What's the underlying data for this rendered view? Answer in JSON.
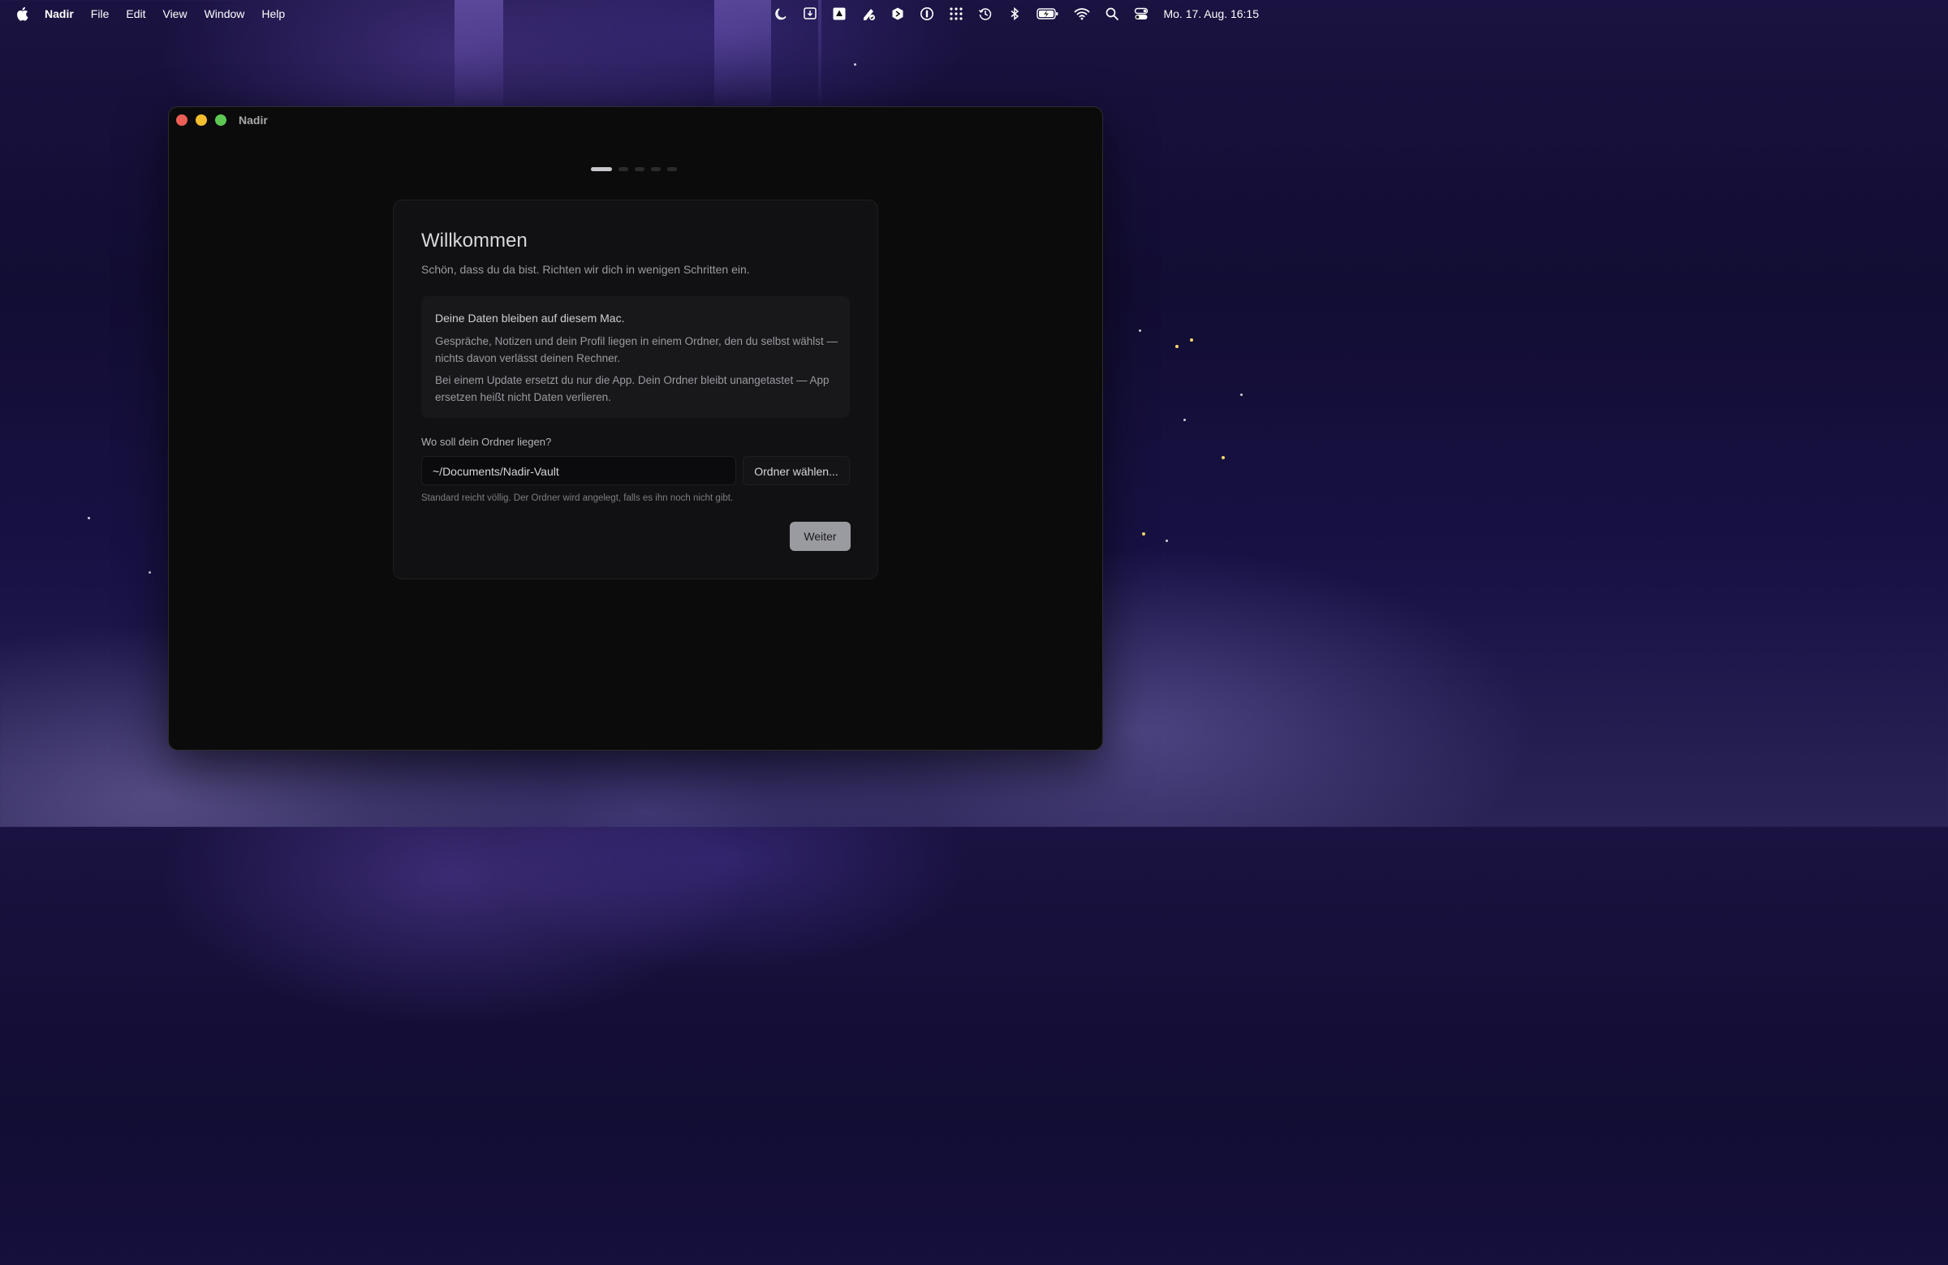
{
  "menubar": {
    "app_name": "Nadir",
    "items": [
      "File",
      "Edit",
      "View",
      "Window",
      "Help"
    ],
    "clock": "Mo. 17. Aug.  16:15",
    "tray_icons": [
      "moon-icon",
      "shield-download-icon",
      "drive-icon",
      "paint-check-icon",
      "hexagon-icon",
      "password-icon",
      "grid-dots-icon",
      "time-machine-icon",
      "bluetooth-icon",
      "battery-charging-icon",
      "wifi-icon",
      "search-icon",
      "control-center-icon"
    ]
  },
  "window": {
    "title": "Nadir",
    "steps": {
      "total": 5,
      "current": 1
    }
  },
  "onboarding": {
    "title": "Willkommen",
    "subtitle": "Schön, dass du da bist. Richten wir dich in wenigen Schritten ein.",
    "info": {
      "heading": "Deine Daten bleiben auf diesem Mac.",
      "paragraph1": "Gespräche, Notizen und dein Profil liegen in einem Ordner, den du selbst wählst — nichts davon verlässt deinen Rechner.",
      "paragraph2": "Bei einem Update ersetzt du nur die App. Dein Ordner bleibt unangetastet — App ersetzen heißt nicht Daten verlieren."
    },
    "folder_question": "Wo soll dein Ordner liegen?",
    "folder_path": "~/Documents/Nadir-Vault",
    "choose_button": "Ordner wählen...",
    "hint": "Standard reicht völlig. Der Ordner wird angelegt, falls es ihn noch nicht gibt.",
    "next_button": "Weiter"
  },
  "colors": {
    "traffic_red": "#ec5f57",
    "traffic_yellow": "#f4be2f",
    "traffic_green": "#5ec754",
    "primary_button": "#9a9aa1"
  }
}
